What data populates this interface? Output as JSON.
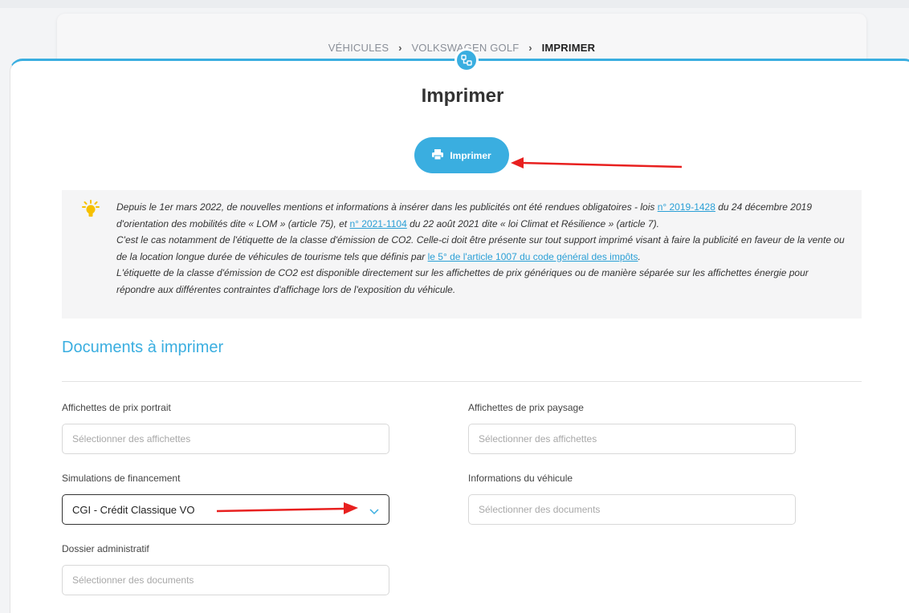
{
  "breadcrumb": {
    "items": [
      "VÉHICULES",
      "VOLKSWAGEN GOLF",
      "IMPRIMER"
    ],
    "separator": ">"
  },
  "page_title": "Imprimer",
  "print_button_label": "Imprimer",
  "info": {
    "p1_a": "Depuis le 1er mars 2022, de nouvelles mentions et informations à insérer dans les publicités ont été rendues obligatoires - lois ",
    "link1": "n° 2019-1428",
    "p1_b": " du 24 décembre 2019 d'orientation des mobilités dite « LOM » (article 75), et ",
    "link2": "n° 2021-1104",
    "p1_c": " du 22 août 2021 dite « loi Climat et Résilience » (article 7).",
    "p2_a": "C'est le cas notamment de l'étiquette de la classe d'émission de CO2. Celle-ci doit être présente sur tout support imprimé visant à faire la publicité en faveur de la vente ou de la location longue durée de véhicules de tourisme tels que définis par ",
    "link3": "le 5° de l'article 1007 du code général des impôts",
    "p2_b": ".",
    "p3": "L'étiquette de la classe d'émission de CO2 est disponible directement sur les affichettes de prix génériques ou de manière séparée sur les affichettes énergie pour répondre aux différentes contraintes d'affichage lors de l'exposition du véhicule."
  },
  "section_title": "Documents à imprimer",
  "fields": {
    "portrait": {
      "label": "Affichettes de prix portrait",
      "placeholder": "Sélectionner des affichettes"
    },
    "paysage": {
      "label": "Affichettes de prix paysage",
      "placeholder": "Sélectionner des affichettes"
    },
    "financement": {
      "label": "Simulations de financement",
      "value": "CGI - Crédit Classique VO"
    },
    "vehicule": {
      "label": "Informations du véhicule",
      "placeholder": "Sélectionner des documents"
    },
    "dossier": {
      "label": "Dossier administratif",
      "placeholder": "Sélectionner des documents"
    }
  },
  "colors": {
    "accent": "#3aaee0",
    "annotation_arrow": "#e8201f",
    "bulb": "#f6c000"
  },
  "icons": [
    "network-icon",
    "printer-icon",
    "lightbulb-icon",
    "chevron-down-icon",
    "chevron-right-icon"
  ]
}
